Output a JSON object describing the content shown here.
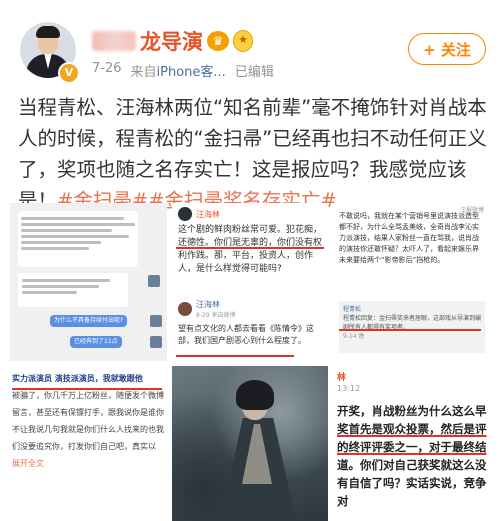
{
  "header": {
    "username": "龙导演",
    "timestamp": "7-26",
    "source_prefix": "来自",
    "source": "iPhone客...",
    "edited": "已编辑",
    "follow_label": "+ 关注",
    "crown_badge": "♛",
    "medal_badge": "★",
    "verified_badge": "V"
  },
  "post": {
    "text_main": "当程青松、汪海林两位“知名前辈”毫不掩饰针对肖战本人的时候，程青松的“金扫帚”已经再也扫不动任何正义了，奖项也随之名存实亡！这是报应吗？我感觉应该是！",
    "hashtag_1": "#金扫帚#",
    "hashtag_2": "#金扫帚奖名存实亡#"
  },
  "grid": {
    "cell1": {
      "chat_blue_1": "为什么不具备持续付出呢?",
      "chat_blue_2": "已经奔到了11点"
    },
    "cell2": {
      "author": "汪海林",
      "text": "这个剧的鲜肉粉丝常可爱。犯花痴，还德性。你们是无辜的，你们没有权利作践。那，平台，投资人，创作人，是什么样觉得可能吗?",
      "sub_author": "汪海林",
      "sub_meta": "8-29 来自微博",
      "sub_text": "望有点文化的人都去看看《陈情令》这部，我们国产剧恶心到什么程度了。"
    },
    "cell3": {
      "label": "汪报微博",
      "text": "不敢说吗，我就在某个营销号里说演技派造型都不好，为什么全骂孟美岐，全奇肖战李沁实力派演技，结果人家粉丝一直在骂我，说肖战的演技你还敢怀疑？太吓人了，看起来娱乐界未来要给两个“影帝影后”挡枪的。",
      "quote_name": "程青松",
      "quote_text": "程青松回复：金扫帚奖来者居眼，这部戏从导演到编剧所有人都得有奖项者。",
      "quote_meta": "9-14 晚"
    },
    "cell4": {
      "text_head": "实力派演员 演技派演员，我就敢跟他",
      "text_body": "被骗了，你几千万上亿粉丝，随便发个微博留言，甚至还有保镖打手，跟我说你是谁你不让我说几句我就是你们什么人找来的也我们没要追究你，打发你们自己吧，真实以",
      "more": "展开全文"
    },
    "cell6": {
      "author": "林",
      "time": "13:12",
      "text_1": "开奖，肖战粉丝为什么这么早",
      "text_2": "奖首先是观众投票，然后是评",
      "text_3": "的终评评委之一，对于最终结",
      "text_4": "道。你们对自己获奖就这么没",
      "text_5": "有自信了吗？实话实说，竞争对"
    }
  },
  "colors": {
    "accent": "#ff8200",
    "hashtag": "#eb7350",
    "username": "#e8542a"
  }
}
